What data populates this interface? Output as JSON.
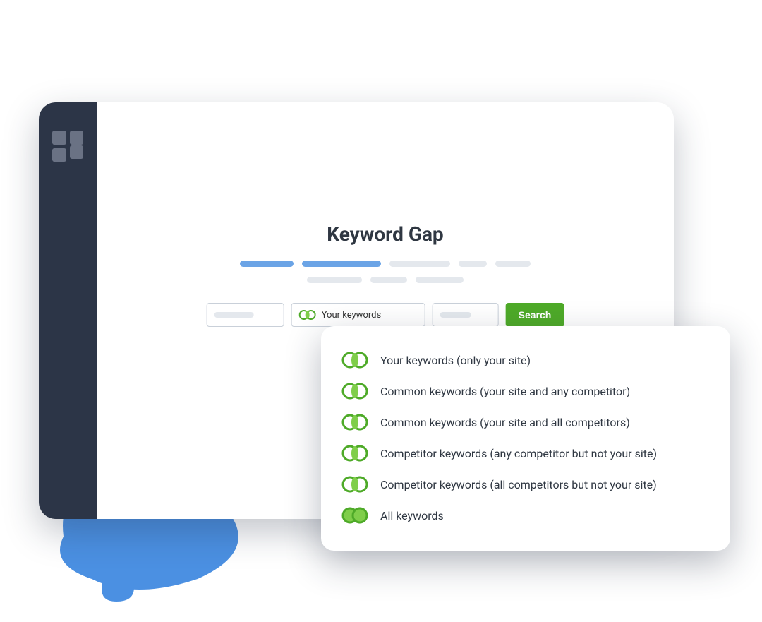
{
  "page": {
    "title": "Keyword Gap"
  },
  "form": {
    "keyword_field_label": "Your keywords",
    "search_button_label": "Search"
  },
  "dropdown": {
    "items": [
      {
        "label": "Your keywords (only your site)"
      },
      {
        "label": "Common keywords (your site and any competitor)"
      },
      {
        "label": "Common keywords (your site and all competitors)"
      },
      {
        "label": "Competitor keywords (any competitor but not your site)"
      },
      {
        "label": "Competitor keywords (all competitors but not your site)"
      },
      {
        "label": "All keywords"
      }
    ]
  },
  "colors": {
    "accent_blue": "#4b90e2",
    "accent_green": "#4eaa28",
    "sidebar": "#2c3547"
  }
}
